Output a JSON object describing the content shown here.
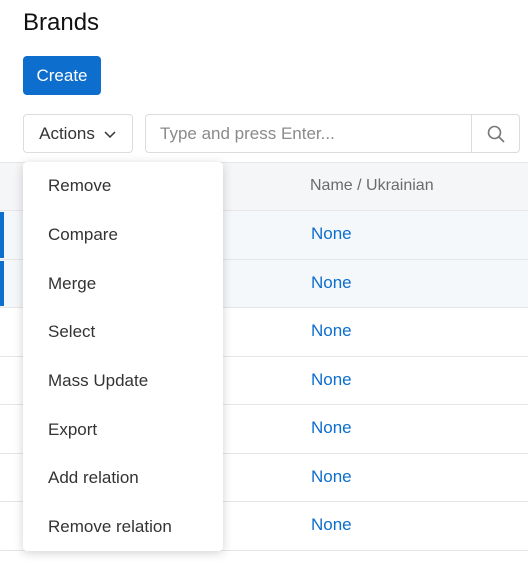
{
  "page": {
    "title": "Brands"
  },
  "toolbar": {
    "create_label": "Create",
    "actions_label": "Actions",
    "search_placeholder": "Type and press Enter..."
  },
  "table": {
    "columns": [
      "Name / Ukrainian"
    ],
    "rows": [
      {
        "name_ukrainian": "None",
        "selected": true
      },
      {
        "name_ukrainian": "None",
        "selected": true
      },
      {
        "name_ukrainian": "None",
        "selected": false
      },
      {
        "name_ukrainian": "None",
        "selected": false
      },
      {
        "name_ukrainian": "None",
        "selected": false
      },
      {
        "name_ukrainian": "None",
        "selected": false
      },
      {
        "name_ukrainian": "None",
        "selected": false
      }
    ]
  },
  "actions_menu": {
    "items": [
      "Remove",
      "Compare",
      "Merge",
      "Select",
      "Mass Update",
      "Export",
      "Add relation",
      "Remove relation"
    ]
  },
  "colors": {
    "accent": "#0d6ecd"
  }
}
